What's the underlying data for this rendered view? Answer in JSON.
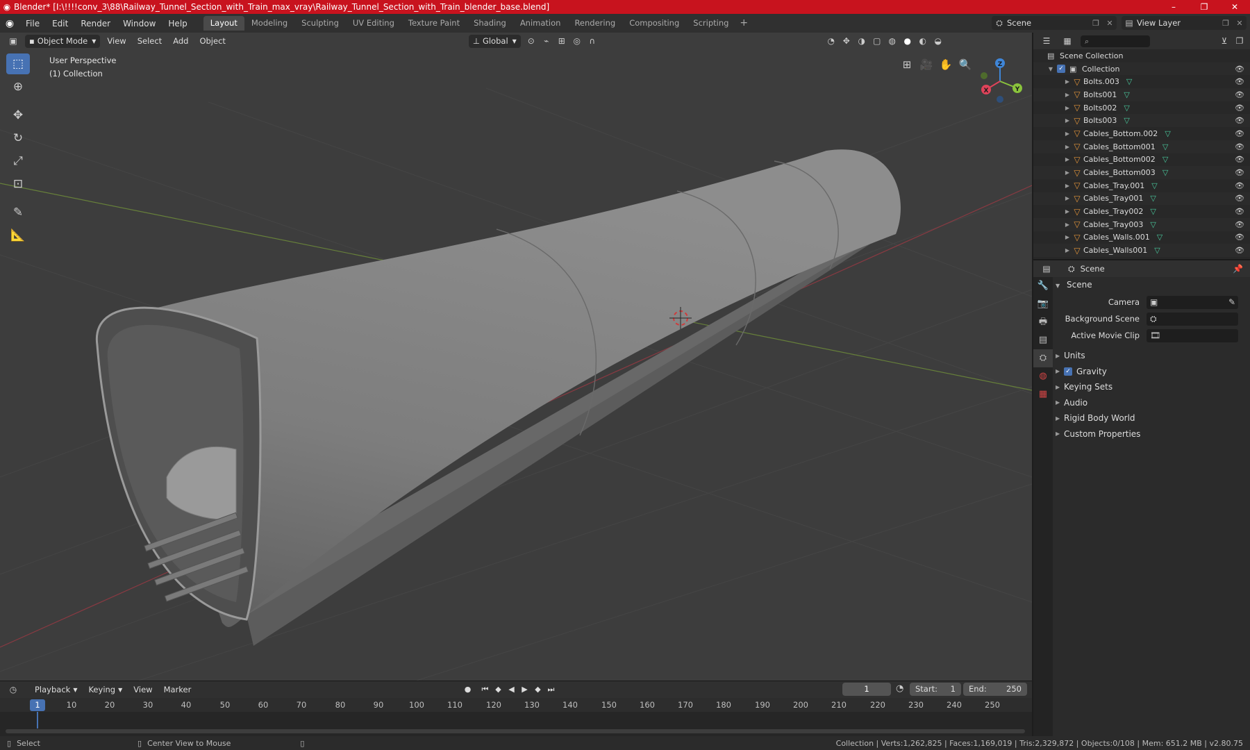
{
  "window": {
    "title": "Blender* [I:\\!!!!conv_3\\88\\Railway_Tunnel_Section_with_Train_max_vray\\Railway_Tunnel_Section_with_Train_blender_base.blend]",
    "minimize": "–",
    "maximize": "❐",
    "close": "✕"
  },
  "menu": [
    "File",
    "Edit",
    "Render",
    "Window",
    "Help"
  ],
  "workspaces": [
    "Layout",
    "Modeling",
    "Sculpting",
    "UV Editing",
    "Texture Paint",
    "Shading",
    "Animation",
    "Rendering",
    "Compositing",
    "Scripting"
  ],
  "workspace_add": "+",
  "scene_selector": "Scene",
  "view_layer_selector": "View Layer",
  "viewport": {
    "mode": "Object Mode",
    "menus": [
      "View",
      "Select",
      "Add",
      "Object"
    ],
    "transform_orientation": "Global",
    "perspective_label": "User Perspective",
    "collection_label": "(1) Collection"
  },
  "gizmo": {
    "x": "X",
    "y": "Y",
    "z": "Z"
  },
  "timeline": {
    "menus": [
      "Playback",
      "Keying",
      "View",
      "Marker"
    ],
    "current_frame": "1",
    "start_label": "Start:",
    "start": "1",
    "end_label": "End:",
    "end": "250",
    "ticks": [
      "10",
      "20",
      "30",
      "40",
      "50",
      "60",
      "70",
      "80",
      "90",
      "100",
      "110",
      "120",
      "130",
      "140",
      "150",
      "160",
      "170",
      "180",
      "190",
      "200",
      "210",
      "220",
      "230",
      "240",
      "250"
    ],
    "playhead": "1"
  },
  "status": {
    "select": "Select",
    "center_view": "Center View to Mouse",
    "stats": "Collection | Verts:1,262,825 | Faces:1,169,019 | Tris:2,329,872 | Objects:0/108 | Mem: 651.2 MB | v2.80.75"
  },
  "outliner": {
    "root": "Scene Collection",
    "collection": "Collection",
    "items": [
      "Bolts.003",
      "Bolts001",
      "Bolts002",
      "Bolts003",
      "Cables_Bottom.002",
      "Cables_Bottom001",
      "Cables_Bottom002",
      "Cables_Bottom003",
      "Cables_Tray.001",
      "Cables_Tray001",
      "Cables_Tray002",
      "Cables_Tray003",
      "Cables_Walls.001",
      "Cables_Walls001"
    ]
  },
  "properties": {
    "context": "Scene",
    "panel": "Scene",
    "camera_label": "Camera",
    "background_scene_label": "Background Scene",
    "active_clip_label": "Active Movie Clip",
    "subpanels": [
      "Units",
      "Gravity",
      "Keying Sets",
      "Audio",
      "Rigid Body World",
      "Custom Properties"
    ]
  },
  "colors": {
    "accent": "#4772b3",
    "titlebar": "#c8131e",
    "x_axis": "#e0435a",
    "y_axis": "#8ac43c",
    "z_axis": "#3f86d8"
  }
}
